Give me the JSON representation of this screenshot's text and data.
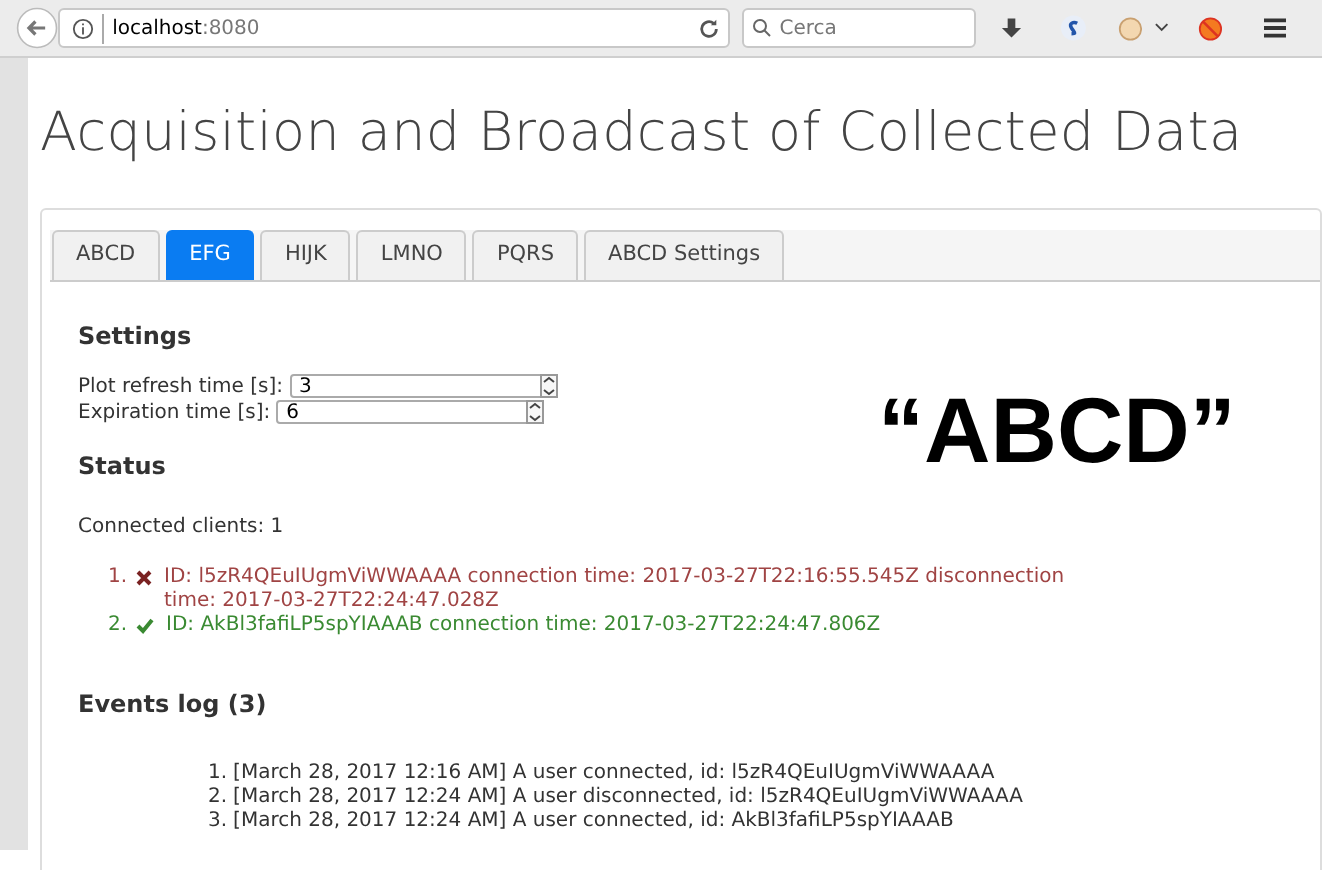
{
  "browser": {
    "url_host": "localhost",
    "url_port": ":8080",
    "search_placeholder": "Cerca"
  },
  "title": "Acquisition and Broadcast of Collected Data",
  "tabs": [
    {
      "label": "ABCD",
      "selected": false
    },
    {
      "label": "EFG",
      "selected": true
    },
    {
      "label": "HIJK",
      "selected": false
    },
    {
      "label": "LMNO",
      "selected": false
    },
    {
      "label": "PQRS",
      "selected": false
    },
    {
      "label": "ABCD Settings",
      "selected": false
    }
  ],
  "settings": {
    "heading": "Settings",
    "fields": [
      {
        "label": "Plot refresh time [s]:",
        "value": "3"
      },
      {
        "label": "Expiration time [s]:",
        "value": "6"
      }
    ]
  },
  "overlay_text": "“ABCD”",
  "status": {
    "heading": "Status",
    "connected_clients": "Connected clients: 1",
    "clients": [
      {
        "number": "1.",
        "connected": false,
        "text": "ID: l5zR4QEuIUgmViWWAAAA connection time: 2017-03-27T22:16:55.545Z disconnection time: 2017-03-27T22:24:47.028Z"
      },
      {
        "number": "2.",
        "connected": true,
        "text": "ID: AkBl3fafiLP5spYIAAAB connection time: 2017-03-27T22:24:47.806Z"
      }
    ]
  },
  "events_log": {
    "heading": "Events log (3)",
    "events": [
      {
        "number": "1.",
        "text": "[March 28, 2017 12:16 AM] A user connected, id: l5zR4QEuIUgmViWWAAAA"
      },
      {
        "number": "2.",
        "text": "[March 28, 2017 12:24 AM] A user disconnected, id: l5zR4QEuIUgmViWWAAAA"
      },
      {
        "number": "3.",
        "text": "[March 28, 2017 12:24 AM] A user connected, id: AkBl3fafiLP5spYIAAAB"
      }
    ]
  }
}
